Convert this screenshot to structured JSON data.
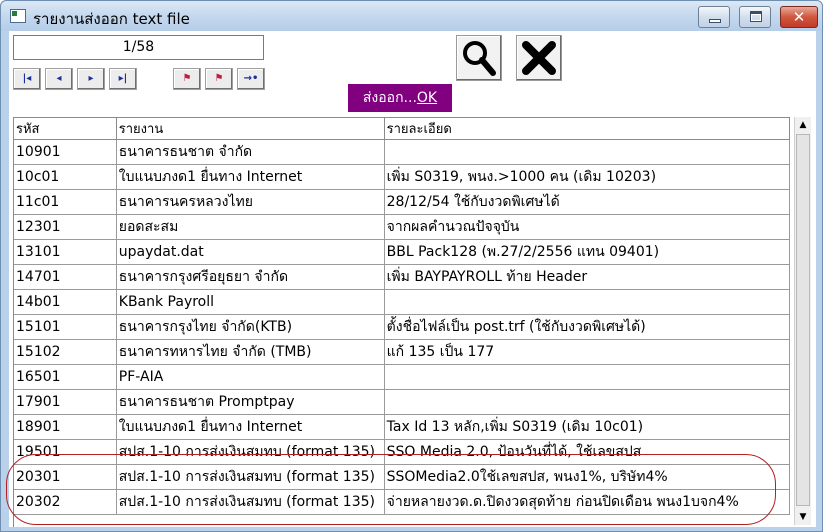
{
  "window": {
    "title": "รายงานส่งออก text file",
    "controls": {
      "minimize": "minimize",
      "maximize": "maximize",
      "close": "✕"
    }
  },
  "toolbar": {
    "page_indicator": "1/58",
    "nav_buttons": [
      {
        "icon": "first-record-icon",
        "glyph": "|◂"
      },
      {
        "icon": "previous-record-icon",
        "glyph": "◂"
      },
      {
        "icon": "next-record-icon",
        "glyph": "▸"
      },
      {
        "icon": "last-record-icon",
        "glyph": "▸|"
      },
      {
        "icon": "flag-icon",
        "glyph": "⚑"
      },
      {
        "icon": "flag-list-icon",
        "glyph": "⚑"
      },
      {
        "icon": "go-record-icon",
        "glyph": "→•"
      }
    ],
    "search_icon": "magnifier-icon",
    "close_icon": "x-icon",
    "export_label_prefix": "ส่งออก...",
    "export_label_hotkey": "OK"
  },
  "table": {
    "columns": [
      "รหัส",
      "รายงาน",
      "รายละเอียด"
    ],
    "rows": [
      {
        "code": "10901",
        "report": "ธนาคารธนชาต จำกัด",
        "detail": ""
      },
      {
        "code": "10c01",
        "report": "ใบแนบภงด1 ยื่นทาง Internet",
        "detail": "เพิ่ม S0319, พนง.>1000 คน (เดิม 10203)"
      },
      {
        "code": "11c01",
        "report": "ธนาคารนครหลวงไทย",
        "detail": "28/12/54 ใช้กับงวดพิเศษได้"
      },
      {
        "code": "12301",
        "report": "ยอดสะสม",
        "detail": "จากผลคำนวณปัจจุบัน"
      },
      {
        "code": "13101",
        "report": "upaydat.dat",
        "detail": "BBL Pack128 (พ.27/2/2556 แทน 09401)"
      },
      {
        "code": "14701",
        "report": "ธนาคารกรุงศรีอยุธยา จำกัด",
        "detail": "เพิ่ม BAYPAYROLL ท้าย Header"
      },
      {
        "code": "14b01",
        "report": "KBank Payroll",
        "detail": ""
      },
      {
        "code": "15101",
        "report": "ธนาคารกรุงไทย จำกัด(KTB)",
        "detail": "ตั้งชื่อไฟล์เป็น post.trf (ใช้กับงวดพิเศษได้)"
      },
      {
        "code": "15102",
        "report": "ธนาคารทหารไทย จำกัด (TMB)",
        "detail": "แก้ 135 เป็น 177"
      },
      {
        "code": "16501",
        "report": "PF-AIA",
        "detail": ""
      },
      {
        "code": "17901",
        "report": "ธนาคารธนชาต Promptpay",
        "detail": ""
      },
      {
        "code": "18901",
        "report": "ใบแนบภงด1 ยื่นทาง Internet",
        "detail": "Tax Id 13 หลัก,เพิ่ม S0319 (เดิม 10c01)"
      },
      {
        "code": "19501",
        "report": "สปส.1-10 การส่งเงินสมทบ (format 135)",
        "detail": "SSO Media 2.0, ป้อนวันที่ได้, ใช้เลขสปส"
      },
      {
        "code": "20301",
        "report": "สปส.1-10 การส่งเงินสมทบ (format 135)",
        "detail": "SSOMedia2.0ใช้เลขสปส, พนง1%, บริษัท4%"
      },
      {
        "code": "20302",
        "report": "สปส.1-10 การส่งเงินสมทบ (format 135)",
        "detail": "จ่ายหลายงวด.ด.ปิดงวดสุดท้าย ก่อนปิดเดือน พนง1บจก4%"
      }
    ]
  },
  "scrollbar": {
    "up": "▲",
    "down": "▼"
  }
}
